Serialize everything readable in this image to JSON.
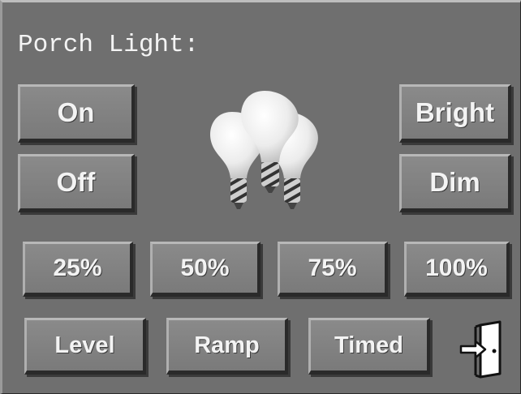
{
  "device": {
    "title": "Porch Light:"
  },
  "buttons": {
    "on": "On",
    "off": "Off",
    "bright": "Bright",
    "dim": "Dim",
    "p25": "25%",
    "p50": "50%",
    "p75": "75%",
    "p100": "100%",
    "level": "Level",
    "ramp": "Ramp",
    "timed": "Timed"
  },
  "icons": {
    "bulb": "light-bulbs-icon",
    "exit": "exit-door-icon"
  },
  "colors": {
    "panel": "#6f6f6f",
    "button": "#808080",
    "text": "#f3f3f3"
  }
}
